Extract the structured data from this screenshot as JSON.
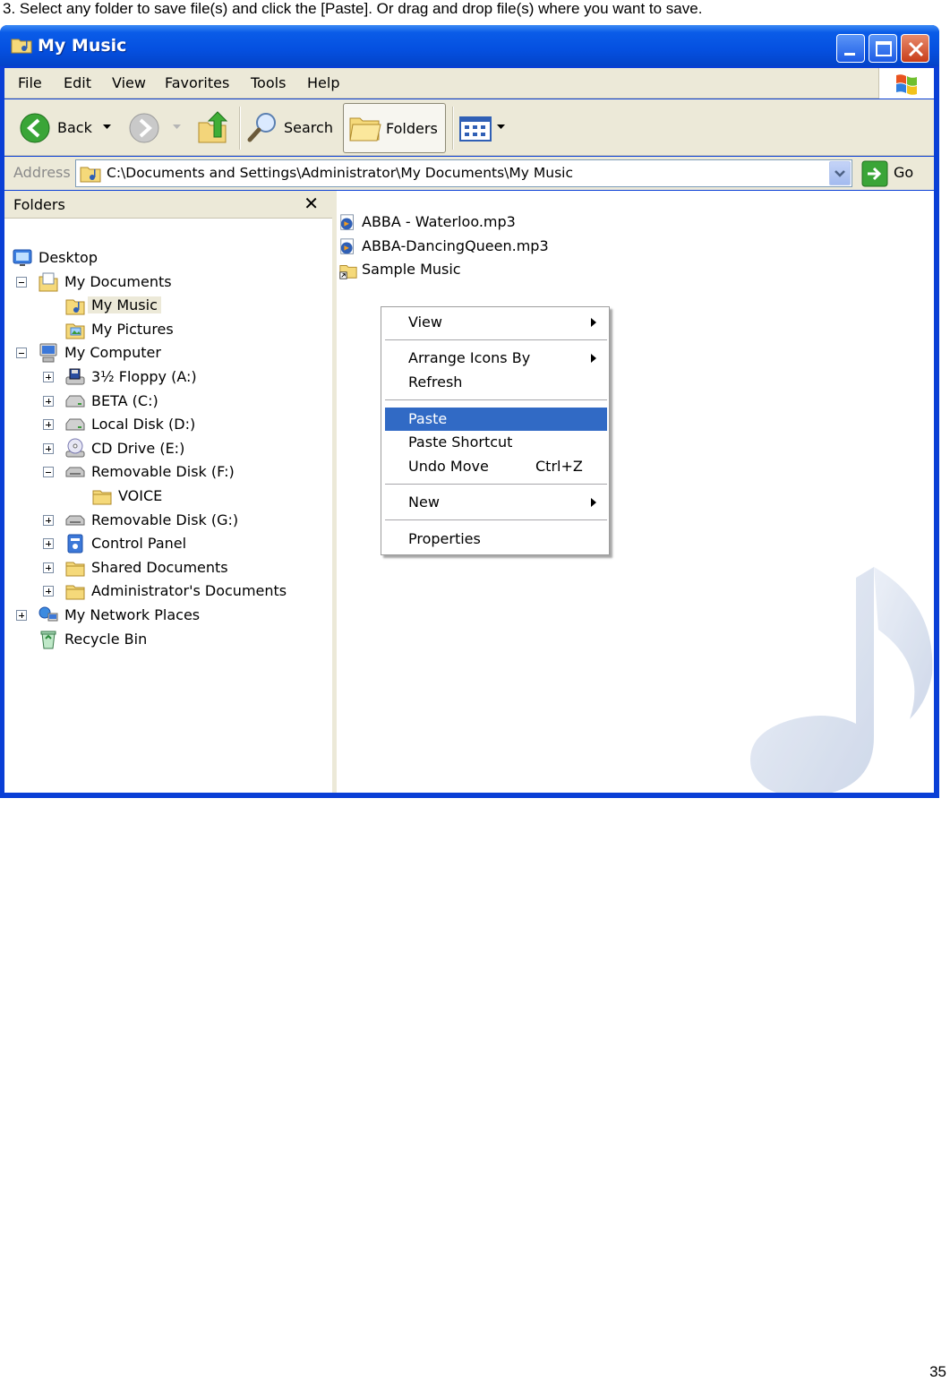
{
  "instruction": "3. Select any folder to save file(s) and click the [Paste].  Or drag and drop file(s) where you want to save.",
  "page_number": "35",
  "window": {
    "title": "My Music",
    "menu": [
      "File",
      "Edit",
      "View",
      "Favorites",
      "Tools",
      "Help"
    ],
    "toolbar": {
      "back_label": "Back",
      "search_label": "Search",
      "folders_label": "Folders"
    },
    "address": {
      "label": "Address",
      "value": "C:\\Documents and Settings\\Administrator\\My Documents\\My Music",
      "go_label": "Go"
    }
  },
  "folder_pane": {
    "title": "Folders",
    "close": "✕",
    "tree": [
      {
        "label": "Desktop",
        "icon": "desktop-icon",
        "level": 0,
        "expander": "none"
      },
      {
        "label": "My Documents",
        "icon": "my-documents-icon",
        "level": 1,
        "expander": "minus"
      },
      {
        "label": "My Music",
        "icon": "my-music-folder-icon",
        "level": 2,
        "expander": "none",
        "selected": true
      },
      {
        "label": "My Pictures",
        "icon": "my-pictures-folder-icon",
        "level": 2,
        "expander": "none"
      },
      {
        "label": "My Computer",
        "icon": "computer-icon",
        "level": 1,
        "expander": "minus"
      },
      {
        "label": "3½ Floppy (A:)",
        "icon": "floppy-drive-icon",
        "level": 2,
        "expander": "plus"
      },
      {
        "label": "BETA (C:)",
        "icon": "hard-drive-icon",
        "level": 2,
        "expander": "plus"
      },
      {
        "label": "Local Disk (D:)",
        "icon": "hard-drive-icon",
        "level": 2,
        "expander": "plus"
      },
      {
        "label": "CD Drive (E:)",
        "icon": "cd-drive-icon",
        "level": 2,
        "expander": "plus"
      },
      {
        "label": "Removable Disk (F:)",
        "icon": "removable-disk-icon",
        "level": 2,
        "expander": "minus"
      },
      {
        "label": "VOICE",
        "icon": "folder-icon",
        "level": 3,
        "expander": "none"
      },
      {
        "label": "Removable Disk (G:)",
        "icon": "removable-disk-icon",
        "level": 2,
        "expander": "plus"
      },
      {
        "label": "Control Panel",
        "icon": "control-panel-icon",
        "level": 2,
        "expander": "plus"
      },
      {
        "label": "Shared Documents",
        "icon": "folder-icon",
        "level": 2,
        "expander": "plus"
      },
      {
        "label": "Administrator's Documents",
        "icon": "folder-icon",
        "level": 2,
        "expander": "plus"
      },
      {
        "label": "My Network Places",
        "icon": "network-places-icon",
        "level": 1,
        "expander": "plus"
      },
      {
        "label": "Recycle Bin",
        "icon": "recycle-bin-icon",
        "level": 1,
        "expander": "none"
      }
    ]
  },
  "files": [
    {
      "label": "ABBA - Waterloo.mp3",
      "icon": "mp3-file-icon"
    },
    {
      "label": "ABBA-DancingQueen.mp3",
      "icon": "mp3-file-icon"
    },
    {
      "label": "Sample Music",
      "icon": "folder-shortcut-icon"
    }
  ],
  "context_menu": {
    "items": [
      {
        "label": "View",
        "submenu": true
      },
      {
        "label": "Arrange Icons By",
        "submenu": true
      },
      {
        "label": "Refresh"
      },
      {
        "label": "Paste",
        "highlighted": true
      },
      {
        "label": "Paste Shortcut"
      },
      {
        "label": "Undo Move",
        "shortcut": "Ctrl+Z"
      },
      {
        "label": "New",
        "submenu": true
      },
      {
        "label": "Properties"
      }
    ]
  },
  "colors": {
    "titlebar": "#0550e0",
    "highlight": "#316ac5",
    "chrome": "#ece9d8"
  }
}
